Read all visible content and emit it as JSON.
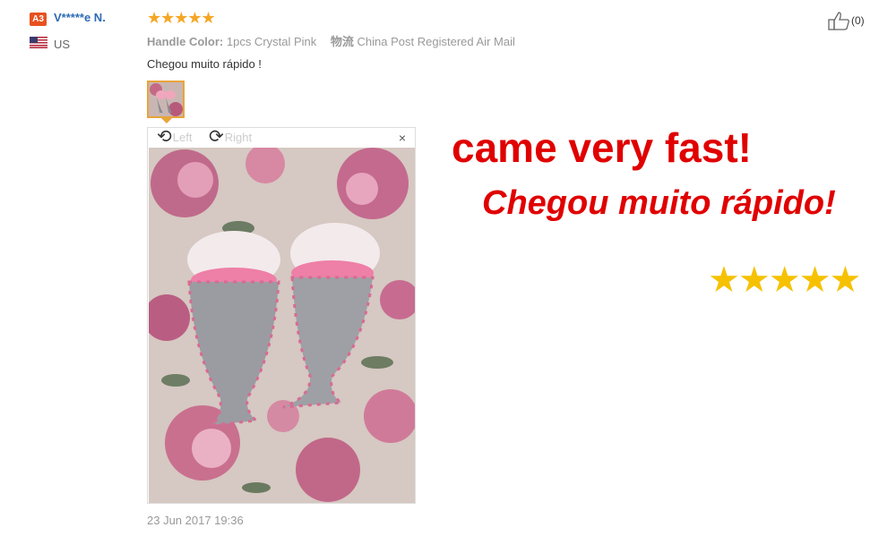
{
  "review": {
    "level_badge": "A3",
    "username": "V*****e N.",
    "country": "US",
    "rating": 5,
    "stars_text": "★★★★★",
    "attributes": [
      {
        "key": "Handle Color:",
        "value": "1pcs Crystal Pink"
      },
      {
        "key": "物流",
        "value": "China Post Registered Air Mail"
      }
    ],
    "feedback": "Chegou muito rápido !",
    "date": "23 Jun 2017 19:36",
    "likes": "(0)"
  },
  "viewer": {
    "rotate_left": "Left",
    "rotate_right": "Right",
    "close": "×"
  },
  "overlay": {
    "line1": "came very fast!",
    "line2": "Chegou muito rápido!",
    "stars": "★★★★★"
  },
  "colors": {
    "accent_orange": "#e8501f",
    "star_gold": "#f5a623",
    "overlay_red": "#e00000",
    "overlay_star": "#f6c100",
    "username_blue": "#2d6bb5"
  },
  "icons": [
    "flag-us-icon",
    "thumbs-up-icon",
    "rotate-left-icon",
    "rotate-right-icon",
    "close-icon"
  ]
}
